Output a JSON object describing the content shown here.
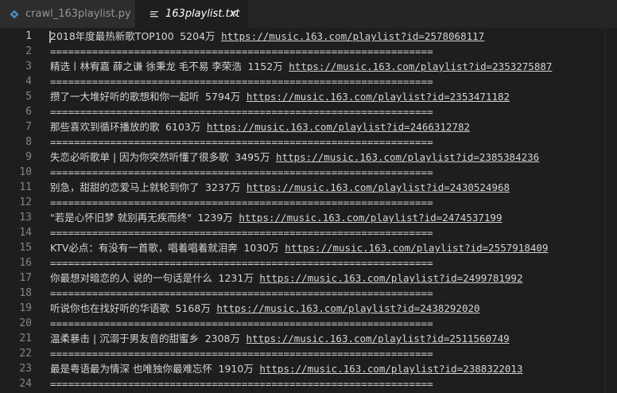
{
  "tabs": [
    {
      "label": "crawl_163playlist.py",
      "icon": "python-icon"
    },
    {
      "label": "163playlist.txt",
      "icon": "text-file-icon",
      "close": "×"
    }
  ],
  "editor": {
    "lines": [
      {
        "num": "1",
        "title": "2018年度最热新歌TOP100",
        "count": "5204万",
        "url": "https://music.163.com/playlist?id=2578068117"
      },
      {
        "num": "2",
        "sep": "================================================================"
      },
      {
        "num": "3",
        "title": "精选丨林宥嘉 薛之谦 徐秉龙 毛不易 李荣浩",
        "count": "1152万",
        "url": "https://music.163.com/playlist?id=2353275887"
      },
      {
        "num": "4",
        "sep": "================================================================"
      },
      {
        "num": "5",
        "title": "攒了一大堆好听的歌想和你一起听",
        "count": "5794万",
        "url": "https://music.163.com/playlist?id=2353471182"
      },
      {
        "num": "6",
        "sep": "================================================================"
      },
      {
        "num": "7",
        "title": "那些喜欢到循环播放的歌",
        "count": "6103万",
        "url": "https://music.163.com/playlist?id=2466312782"
      },
      {
        "num": "8",
        "sep": "================================================================"
      },
      {
        "num": "9",
        "title": "失恋必听歌单 | 因为你突然听懂了很多歌",
        "count": "3495万",
        "url": "https://music.163.com/playlist?id=2385384236"
      },
      {
        "num": "10",
        "sep": "================================================================"
      },
      {
        "num": "11",
        "title": "别急，甜甜的恋爱马上就轮到你了",
        "count": "3237万",
        "url": "https://music.163.com/playlist?id=2430524968"
      },
      {
        "num": "12",
        "sep": "================================================================"
      },
      {
        "num": "13",
        "title": "\"若是心怀旧梦 就别再无疾而终\"",
        "count": "1239万",
        "url": "https://music.163.com/playlist?id=2474537199"
      },
      {
        "num": "14",
        "sep": "================================================================"
      },
      {
        "num": "15",
        "title": "KTV必点：有没有一首歌，唱着唱着就泪奔",
        "count": "1030万",
        "url": "https://music.163.com/playlist?id=2557918409"
      },
      {
        "num": "16",
        "sep": "================================================================"
      },
      {
        "num": "17",
        "title": "你最想对暗恋的人 说的一句话是什么",
        "count": "1231万",
        "url": "https://music.163.com/playlist?id=2499781992"
      },
      {
        "num": "18",
        "sep": "================================================================"
      },
      {
        "num": "19",
        "title": "听说你也在找好听的华语歌",
        "count": "5168万",
        "url": "https://music.163.com/playlist?id=2438292020"
      },
      {
        "num": "20",
        "sep": "================================================================"
      },
      {
        "num": "21",
        "title": "温柔暴击 | 沉溺于男友音的甜蜜乡",
        "count": "2308万",
        "url": "https://music.163.com/playlist?id=2511560749"
      },
      {
        "num": "22",
        "sep": "================================================================"
      },
      {
        "num": "23",
        "title": "最是粤语最为情深 也唯独你最难忘怀",
        "count": "1910万",
        "url": "https://music.163.com/playlist?id=2388322013"
      },
      {
        "num": "24",
        "sep": "================================================================"
      }
    ]
  }
}
